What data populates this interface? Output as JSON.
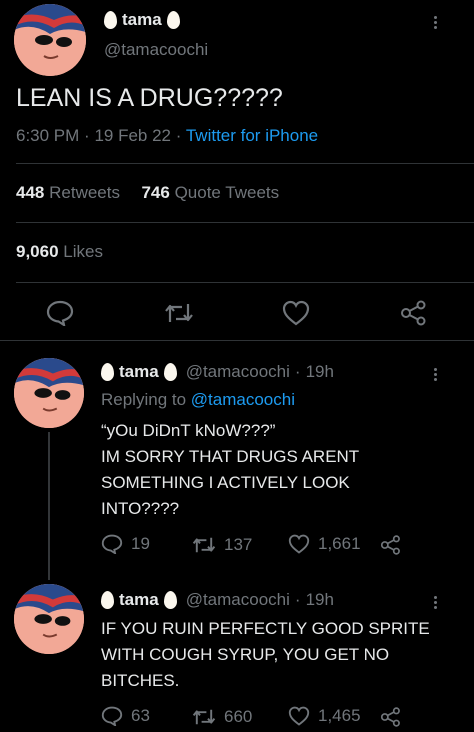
{
  "main_tweet": {
    "author_name": "tama",
    "author_handle": "@tamacoochi",
    "text": "LEAN IS A DRUG?????",
    "time": "6:30 PM",
    "date": "19 Feb 22",
    "source": "Twitter for iPhone",
    "retweets_count": "448",
    "retweets_label": "Retweets",
    "quote_count": "746",
    "quote_label": "Quote Tweets",
    "likes_count": "9,060",
    "likes_label": "Likes"
  },
  "replies": [
    {
      "author_name": "tama",
      "author_handle": "@tamacoochi",
      "age": "19h",
      "replying_prefix": "Replying to",
      "replying_handle": "@tamacoochi",
      "text_lines": [
        "“yOu DiDnT kNoW???”",
        "IM SORRY THAT DRUGS ARENT",
        "SOMETHING I ACTIVELY LOOK",
        "INTO????"
      ],
      "replies": "19",
      "retweets": "137",
      "likes": "1,661"
    },
    {
      "author_name": "tama",
      "author_handle": "@tamacoochi",
      "age": "19h",
      "text_lines": [
        "IF YOU RUIN PERFECTLY GOOD SPRITE",
        "WITH COUGH SYRUP, YOU GET NO",
        "BITCHES."
      ],
      "replies": "63",
      "retweets": "660",
      "likes": "1,465"
    }
  ],
  "separator": "·",
  "colors": {
    "background": "#000000",
    "text": "#e7e9ea",
    "muted": "#71767b",
    "link": "#1d9bf0",
    "divider": "#2f3336"
  }
}
